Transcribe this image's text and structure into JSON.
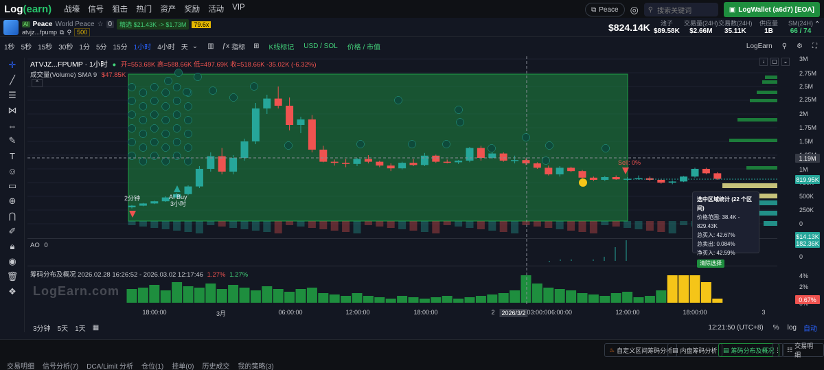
{
  "app": {
    "logo_prefix": "Log",
    "logo_paren": "(earn)",
    "nav": [
      "战壕",
      "信号",
      "狙击",
      "热门",
      "资产",
      "奖励",
      "活动",
      "VIP"
    ],
    "user_pill": "Peace",
    "search_placeholder": "搜索关键词",
    "wallet_label": "LogWallet (a6d7) [EOA]"
  },
  "token": {
    "ai_badge": "AI",
    "name": "Peace",
    "full_name": "World Peace",
    "count_badge": "0",
    "jingxuan": "精选 $21.43K -> $1.73M",
    "jingxuan_mult": "79.6x",
    "address": "atvjz...fpump",
    "followers": "500",
    "price": "$824.14K",
    "stats": [
      {
        "label": "池子",
        "value": "$89.58K"
      },
      {
        "label": "交易量(24H)",
        "value": "$2.66M"
      },
      {
        "label": "交易数(24H)",
        "value": "35.11K"
      },
      {
        "label": "供应量",
        "value": "1B"
      },
      {
        "label": "SM(24H)",
        "value": "66 / 74"
      }
    ]
  },
  "toolbar": {
    "timeframes": [
      "1秒",
      "5秒",
      "15秒",
      "30秒",
      "1分",
      "5分",
      "15分",
      "1小时",
      "4小时",
      "天"
    ],
    "active_tf": "1小时",
    "indicator_label": "指标",
    "kline_label": "K线标记",
    "usd_sol": "USD / SOL",
    "price_mkt": "价格 / 市值",
    "source": "LogEarn"
  },
  "legend": {
    "symbol": "ATVJZ...FPUMP · 1小时",
    "ohlc": "开=553.68K  高=588.66K  低=497.69K  收=518.66K  -35.02K (-6.32%)",
    "volume": "成交量(Volume) SMA 9",
    "volume_val": "$47.85K",
    "ao": "AO",
    "ao_val": "0",
    "chip": "筹码分布及概况 2026.02.28 16:26:52 - 2026.03.02 12:17:46",
    "chip_pct1": "1.27%",
    "chip_pct2": "1.27%"
  },
  "markers": {
    "buy_label": "AI Buy",
    "buy_sub": "3小时",
    "two_min": "2分钟",
    "sell_label": "Sell: 0%",
    "db": "DB"
  },
  "axis": {
    "price_labels": [
      "3M",
      "2.75M",
      "2.5M",
      "2.25M",
      "2M",
      "1.75M",
      "1.5M",
      "1.25M",
      "1M",
      "750K",
      "500K",
      "250K",
      "0"
    ],
    "crosshair_price": "1.19M",
    "last_price": "819.95K",
    "vol_tag1": "$14.13K",
    "vol_tag2": "182.36K",
    "ao_zero": "0",
    "chip_labels": [
      "4%",
      "2%",
      "0%"
    ],
    "chip_tag1": "0.67%",
    "time_labels": [
      "18:00:00",
      "3月",
      "06:00:00",
      "12:00:00",
      "18:00:00",
      "2",
      "2026/3/2",
      "03:00:00",
      "6:00:00",
      "12:00:00",
      "18:00:00",
      "3"
    ]
  },
  "popup": {
    "title": "选中区域统计 (22 个区间)",
    "range": "价格范围: 38.4K - 829.43K",
    "buy": "总买入: 42.67%",
    "sell": "总卖出: 0.084%",
    "net": "净买入: 42.59%",
    "clear": "清除选择"
  },
  "bottom": {
    "tfs": [
      "3分钟",
      "5天",
      "1天"
    ],
    "time": "12:21:50 (UTC+8)",
    "pct": "%",
    "log": "log",
    "auto": "自动",
    "tabs": [
      "交易明细",
      "信号分析(7)",
      "DCA/Limit 分析",
      "仓位(1)",
      "挂单(0)",
      "历史成交",
      "我的策略(3)"
    ],
    "btn1": "自定义区间筹码分析",
    "btn2": "内盘筹码分析",
    "btn3": "筹码分布及概况",
    "btn4": "交易明细",
    "watermark": "LogEarn.com"
  },
  "chart_data": {
    "type": "candlestick",
    "ylim": [
      0,
      3000000
    ],
    "candles": [
      [
        300,
        340,
        280,
        330
      ],
      [
        330,
        380,
        320,
        370
      ],
      [
        370,
        420,
        360,
        410
      ],
      [
        410,
        500,
        400,
        480
      ],
      [
        480,
        560,
        470,
        540
      ],
      [
        540,
        700,
        520,
        680
      ],
      [
        680,
        1050,
        650,
        1000
      ],
      [
        1000,
        1300,
        950,
        1230
      ],
      [
        1230,
        1380,
        900,
        950
      ],
      [
        950,
        1250,
        900,
        1200
      ],
      [
        1200,
        1550,
        1150,
        1500
      ],
      [
        1500,
        2200,
        1450,
        2100
      ],
      [
        2100,
        2350,
        2000,
        2280
      ],
      [
        2280,
        2500,
        2100,
        2150
      ],
      [
        2150,
        2300,
        1700,
        1800
      ],
      [
        1800,
        1950,
        1650,
        1900
      ],
      [
        1900,
        1980,
        1300,
        1350
      ],
      [
        1350,
        1420,
        1120,
        1130
      ],
      [
        1130,
        1170,
        1060,
        1110
      ],
      [
        1110,
        1180,
        1030,
        1090
      ],
      [
        1090,
        1200,
        1050,
        1180
      ],
      [
        1180,
        1250,
        1100,
        1130
      ],
      [
        1130,
        1150,
        1030,
        1060
      ],
      [
        1060,
        1100,
        960,
        1010
      ],
      [
        1010,
        1130,
        990,
        1110
      ],
      [
        1110,
        1180,
        1050,
        1070
      ],
      [
        1070,
        1290,
        1050,
        1240
      ],
      [
        1240,
        1260,
        1110,
        1130
      ],
      [
        1130,
        1170,
        1100,
        1120
      ],
      [
        1120,
        1160,
        1090,
        1150
      ],
      [
        1150,
        1400,
        1120,
        1380
      ],
      [
        1380,
        1420,
        1150,
        1200
      ],
      [
        1200,
        1300,
        1180,
        1280
      ],
      [
        1280,
        1300,
        1130,
        1150
      ],
      [
        1150,
        1240,
        1100,
        1160
      ],
      [
        1160,
        1190,
        1070,
        1100
      ],
      [
        1100,
        1120,
        1000,
        1020
      ],
      [
        1020,
        1060,
        880,
        900
      ],
      [
        900,
        1050,
        860,
        1020
      ],
      [
        1020,
        1040,
        940,
        960
      ],
      [
        960,
        980,
        820,
        840
      ],
      [
        840,
        860,
        780,
        800
      ],
      [
        800,
        870,
        780,
        850
      ],
      [
        850,
        880,
        800,
        810
      ],
      [
        810,
        850,
        780,
        820
      ],
      [
        820,
        880,
        800,
        830
      ],
      [
        830,
        860,
        780,
        800
      ],
      [
        800,
        820,
        730,
        750
      ],
      [
        750,
        790,
        720,
        770
      ],
      [
        770,
        870,
        760,
        860
      ],
      [
        860,
        1020,
        840,
        1000
      ],
      [
        1000,
        1020,
        900,
        920
      ],
      [
        920,
        940,
        800,
        820
      ]
    ]
  }
}
